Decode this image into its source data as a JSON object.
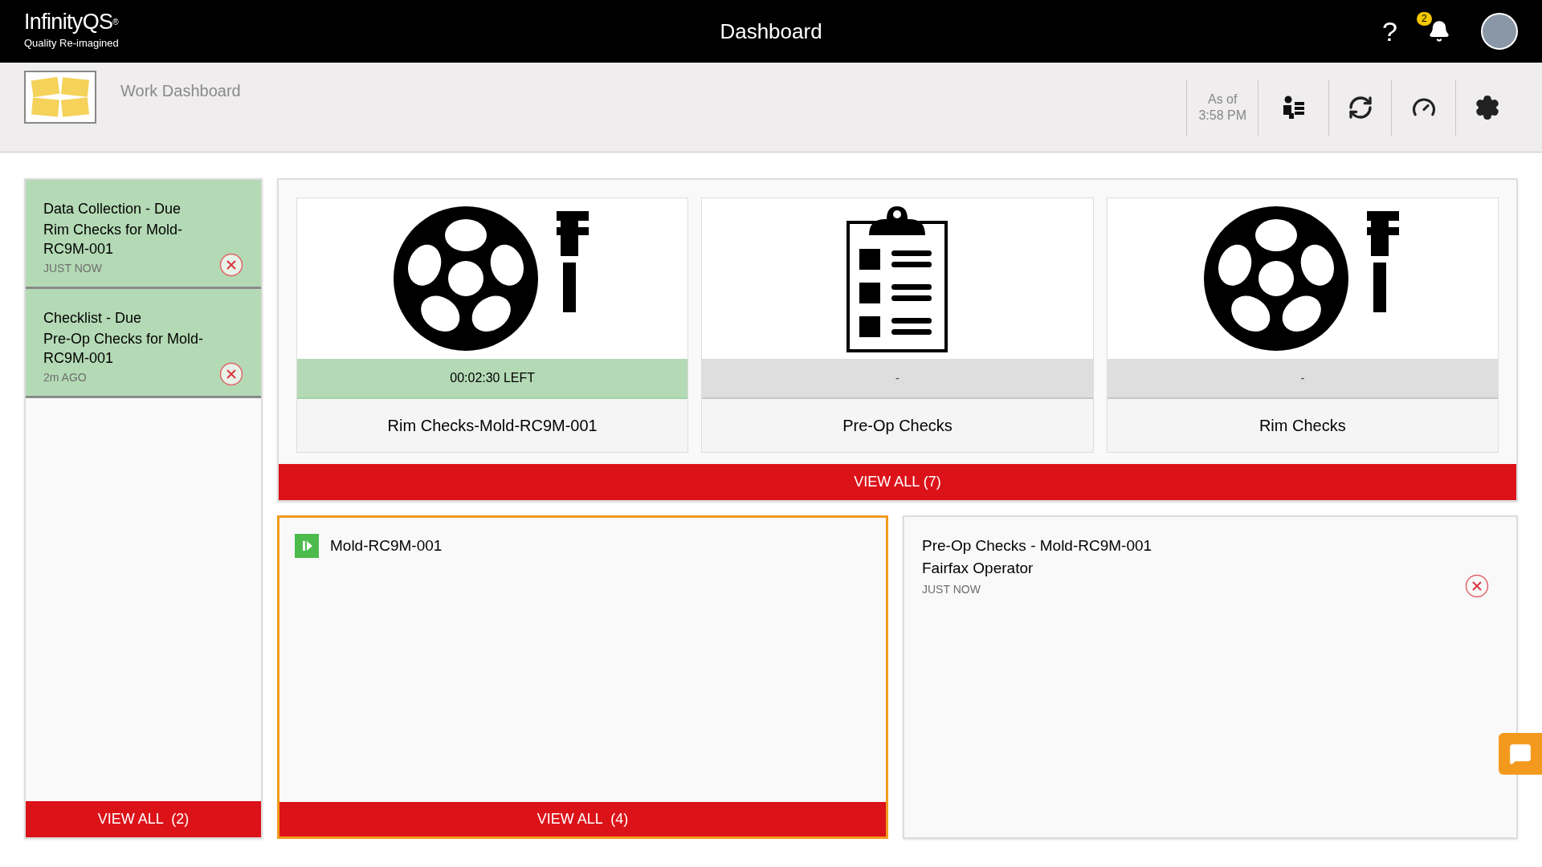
{
  "header": {
    "brand": "InfinityQS",
    "brand_mark": "®",
    "tagline": "Quality Re-imagined",
    "title": "Dashboard",
    "help": "?",
    "notification_count": "2"
  },
  "toolbar": {
    "title": "Work Dashboard",
    "as_of": [
      "As of",
      "3:58 PM"
    ]
  },
  "notifications": {
    "items": [
      {
        "title": "Data Collection - Due",
        "subtitle": "Rim Checks for Mold-RC9M-001",
        "time": "JUST NOW"
      },
      {
        "title": "Checklist - Due",
        "subtitle": "Pre-Op Checks for Mold-RC9M-001",
        "time": "2m AGO"
      }
    ],
    "view_all": "VIEW ALL  (2)"
  },
  "tiles": {
    "items": [
      {
        "kind": "wheel",
        "status": "00:02:30 LEFT",
        "active": true,
        "name": "Rim Checks-Mold-RC9M-001"
      },
      {
        "kind": "clipboard",
        "status": "-",
        "active": false,
        "name": "Pre-Op Checks"
      },
      {
        "kind": "wheel",
        "status": "-",
        "active": false,
        "name": "Rim Checks"
      }
    ],
    "view_all": "VIEW ALL (7)"
  },
  "processes": {
    "selected": true,
    "items": [
      {
        "label": "Mold-RC9M-001"
      }
    ],
    "view_all": "VIEW ALL  (4)"
  },
  "activity": {
    "items": [
      {
        "title": "Pre-Op Checks - Mold-RC9M-001",
        "subtitle": "Fairfax Operator",
        "time": "JUST NOW"
      }
    ]
  }
}
